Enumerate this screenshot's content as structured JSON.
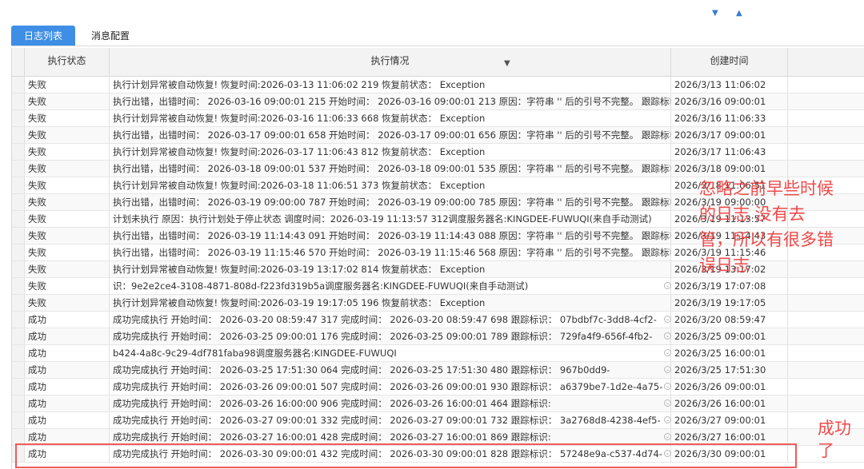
{
  "toolbar": {
    "arrow_down": "▼",
    "arrow_up": "▲"
  },
  "tabs": [
    {
      "label": "日志列表",
      "active": true
    },
    {
      "label": "消息配置",
      "active": false
    }
  ],
  "table": {
    "columns": [
      "执行状态",
      "执行情况",
      "创建时间"
    ],
    "rows": [
      {
        "status": "失败",
        "detail": "执行计划异常被自动恢复! 恢复时间:2026-03-13 11:06:02 219 恢复前状态： Exception",
        "created": "2026/3/13 11:06:02",
        "expand": false
      },
      {
        "status": "失败",
        "detail": "执行出错，出错时间： 2026-03-16 09:00:01 215  开始时间： 2026-03-16 09:00:01 213  原因：字符串 '' 后的引号不完整。  跟踪标",
        "created": "2026/3/16 09:00:01",
        "expand": true
      },
      {
        "status": "失败",
        "detail": "执行计划异常被自动恢复! 恢复时间:2026-03-16 11:06:33 668 恢复前状态： Exception",
        "created": "2026/3/16 11:06:33",
        "expand": false
      },
      {
        "status": "失败",
        "detail": "执行出错，出错时间： 2026-03-17 09:00:01 658  开始时间： 2026-03-17 09:00:01 656  原因：字符串 '' 后的引号不完整。  跟踪标",
        "created": "2026/3/17 09:00:01",
        "expand": true
      },
      {
        "status": "失败",
        "detail": "执行计划异常被自动恢复! 恢复时间:2026-03-17 11:06:43 812 恢复前状态： Exception",
        "created": "2026/3/17 11:06:43",
        "expand": false
      },
      {
        "status": "失败",
        "detail": "执行出错，出错时间： 2026-03-18 09:00:01 537  开始时间： 2026-03-18 09:00:01 535  原因：字符串 '' 后的引号不完整。  跟踪标",
        "created": "2026/3/18 09:00:01",
        "expand": true
      },
      {
        "status": "失败",
        "detail": "执行计划异常被自动恢复! 恢复时间:2026-03-18 11:06:51 373 恢复前状态： Exception",
        "created": "2026/3/18 11:06:51",
        "expand": false
      },
      {
        "status": "失败",
        "detail": "执行出错，出错时间： 2026-03-19 09:00:00 787  开始时间： 2026-03-19 09:00:00 785  原因：字符串 '' 后的引号不完整。  跟踪标",
        "created": "2026/3/19 09:00:00",
        "expand": true
      },
      {
        "status": "失败",
        "detail": "计划未执行  原因：执行计划处于停止状态  调度时间：2026-03-19 11:13:57 312调度服务器名:KINGDEE-FUWUQI(来自手动测试)",
        "created": "2026/3/19 11:13:57",
        "expand": false
      },
      {
        "status": "失败",
        "detail": "执行出错，出错时间： 2026-03-19 11:14:43 091  开始时间： 2026-03-19 11:14:43 088  原因：字符串 '' 后的引号不完整。  跟踪标",
        "created": "2026/3/19 11:14:43",
        "expand": true
      },
      {
        "status": "失败",
        "detail": "执行出错，出错时间： 2026-03-19 11:15:46 570  开始时间： 2026-03-19 11:15:46 568  原因：字符串 '' 后的引号不完整。  跟踪标",
        "created": "2026/3/19 11:15:46",
        "expand": true
      },
      {
        "status": "失败",
        "detail": "执行计划异常被自动恢复! 恢复时间:2026-03-19 13:17:02 814 恢复前状态： Exception",
        "created": "2026/3/19 13:17:02",
        "expand": false
      },
      {
        "status": "失败",
        "detail": "识：9e2e2ce4-3108-4871-808d-f223fd319b5a调度服务器名:KINGDEE-FUWUQI(来自手动测试)",
        "created": "2026/3/19 17:07:08",
        "expand": true
      },
      {
        "status": "失败",
        "detail": "执行计划异常被自动恢复! 恢复时间:2026-03-19 19:17:05 196 恢复前状态： Exception",
        "created": "2026/3/19 19:17:05",
        "expand": false
      },
      {
        "status": "成功",
        "detail": "成功完成执行  开始时间： 2026-03-20 08:59:47 317  完成时间： 2026-03-20 08:59:47 698  跟踪标识： 07bdbf7c-3dd8-4cf2-",
        "created": "2026/3/20 08:59:47",
        "expand": true
      },
      {
        "status": "成功",
        "detail": "成功完成执行  开始时间： 2026-03-25 09:00:01 176  完成时间： 2026-03-25 09:00:01 789  跟踪标识： 729fa4f9-656f-4fb2-",
        "created": "2026/3/25 09:00:01",
        "expand": true
      },
      {
        "status": "成功",
        "detail": "b424-4a8c-9c29-4df781faba98调度服务器名:KINGDEE-FUWUQI",
        "created": "2026/3/25 16:00:01",
        "expand": true
      },
      {
        "status": "成功",
        "detail": "成功完成执行  开始时间： 2026-03-25 17:51:30 064  完成时间： 2026-03-25 17:51:30 480  跟踪标识： 967b0dd9-",
        "created": "2026/3/25 17:51:30",
        "expand": true
      },
      {
        "status": "成功",
        "detail": "成功完成执行  开始时间： 2026-03-26 09:00:01 507  完成时间： 2026-03-26 09:00:01 930  跟踪标识： a6379be7-1d2e-4a75-",
        "created": "2026/3/26 09:00:01",
        "expand": true
      },
      {
        "status": "成功",
        "detail": "成功完成执行  开始时间： 2026-03-26 16:00:00 906  完成时间： 2026-03-26 16:00:01 464  跟踪标识:",
        "created": "2026/3/26 16:00:01",
        "expand": true
      },
      {
        "status": "成功",
        "detail": "成功完成执行  开始时间： 2026-03-27 09:00:01 332  完成时间： 2026-03-27 09:00:01 732  跟踪标识： 3a2768d8-4238-4ef5-",
        "created": "2026/3/27 09:00:01",
        "expand": true
      },
      {
        "status": "成功",
        "detail": "成功完成执行  开始时间： 2026-03-27 16:00:01 428  完成时间： 2026-03-27 16:00:01 869  跟踪标识:",
        "created": "2026/3/27 16:00:01",
        "expand": true
      },
      {
        "status": "成功",
        "detail": "成功完成执行  开始时间： 2026-03-30 09:00:01 432  完成时间： 2026-03-30 09:00:01 828  跟踪标识： 57248e9a-c537-4d74-",
        "created": "2026/3/30 09:00:01",
        "expand": true
      }
    ]
  },
  "annotations": {
    "ignore_note": [
      "忽略之前早些时候",
      "的日志   没有去",
      "管，所以有很多错",
      "误日志"
    ],
    "success_note": [
      "成功",
      "了"
    ],
    "color": "#f04a4a"
  },
  "colors": {
    "accent": "#3f8ee6",
    "header_bg": "#f3f3f3"
  }
}
